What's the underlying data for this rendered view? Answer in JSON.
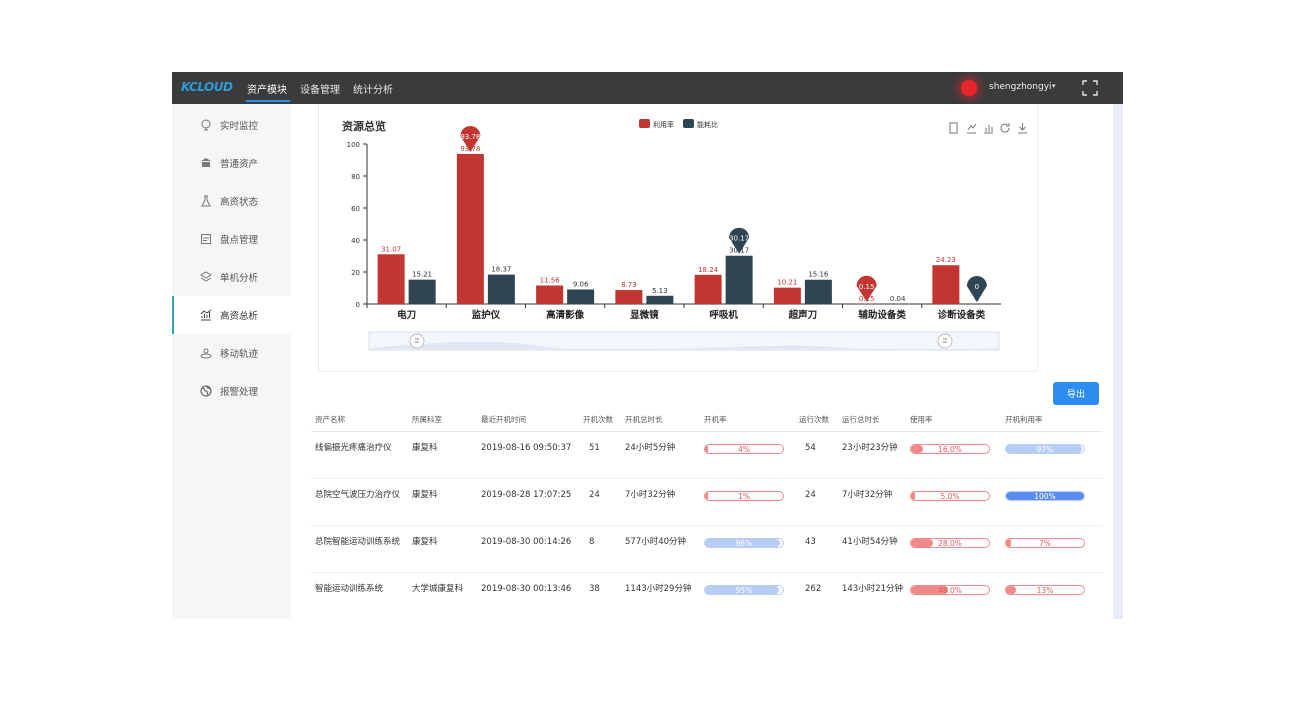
{
  "app": {
    "logo": "KCLOUD",
    "nav": [
      {
        "label": "资产模块",
        "active": true
      },
      {
        "label": "设备管理",
        "active": false
      },
      {
        "label": "统计分析",
        "active": false
      }
    ],
    "username": "shengzhongyi",
    "icons": {
      "user_menu": "chevron-down-icon",
      "fullscreen": "fullscreen-icon",
      "record": "record-dot-icon"
    }
  },
  "sidebar": {
    "items": [
      {
        "label": "实时监控",
        "icon": "monitor-icon",
        "active": false
      },
      {
        "label": "普通资产",
        "icon": "bank-icon",
        "active": false
      },
      {
        "label": "高资状态",
        "icon": "flask-icon",
        "active": false
      },
      {
        "label": "盘点管理",
        "icon": "clipboard-icon",
        "active": false
      },
      {
        "label": "单机分析",
        "icon": "layers-icon",
        "active": false
      },
      {
        "label": "高资总析",
        "icon": "trend-chart-icon",
        "active": true
      },
      {
        "label": "移动轨迹",
        "icon": "route-icon",
        "active": false
      },
      {
        "label": "报警处理",
        "icon": "globe-icon",
        "active": false
      }
    ]
  },
  "colors": {
    "red": "#c23531",
    "navy": "#2f4554",
    "blue": "#2d8cf0",
    "bar_red": "#f08a8a",
    "bar_blue": "#b7cdf4"
  },
  "chart_data": {
    "type": "bar",
    "title": "资源总览",
    "categories": [
      "电刀",
      "监护仪",
      "高清影像",
      "显微镜",
      "呼吸机",
      "超声刀",
      "辅助设备类",
      "诊断设备类"
    ],
    "series": [
      {
        "name": "利用率",
        "values": [
          31.07,
          93.78,
          11.56,
          8.73,
          18.24,
          10.21,
          0.15,
          24.23
        ]
      },
      {
        "name": "能耗比",
        "values": [
          15.21,
          18.37,
          9.06,
          5.13,
          30.17,
          15.16,
          0.04,
          0
        ]
      }
    ],
    "ylim": [
      0,
      100
    ],
    "yticks": [
      0,
      20,
      40,
      60,
      80,
      100
    ],
    "grid": false,
    "legend": "top-center",
    "markers": [
      {
        "series": 0,
        "index": 1,
        "label": "93.78"
      },
      {
        "series": 1,
        "index": 4,
        "label": "30.17"
      },
      {
        "series": 0,
        "index": 6,
        "label": "0.15"
      },
      {
        "series": 1,
        "index": 7,
        "label": "0"
      }
    ],
    "toolbox": [
      "data-view-icon",
      "line-chart-icon",
      "bar-chart-icon",
      "refresh-icon",
      "download-icon"
    ]
  },
  "export_label": "导出",
  "table": {
    "headers": [
      "资产名称",
      "所属科室",
      "最近开机时间",
      "开机次数",
      "开机总时长",
      "开机率",
      "运行次数",
      "运行总时长",
      "使用率",
      "开机利用率"
    ],
    "rows": [
      {
        "name": "线偏振光疼痛治疗仪",
        "dept": "康复科",
        "time": "2019-08-16 09:50:37",
        "boots": "51",
        "boot_dur": "24小时5分钟",
        "boot_rate": {
          "text": "4%",
          "value": 4
        },
        "runs": "54",
        "run_dur": "23小时23分钟",
        "use_rate": {
          "text": "16.0%",
          "value": 16
        },
        "util": {
          "text": "97%",
          "value": 97
        }
      },
      {
        "name": "总院空气波压力治疗仪",
        "dept": "康复科",
        "time": "2019-08-28 17:07:25",
        "boots": "24",
        "boot_dur": "7小时32分钟",
        "boot_rate": {
          "text": "1%",
          "value": 1
        },
        "runs": "24",
        "run_dur": "7小时32分钟",
        "use_rate": {
          "text": "5.0%",
          "value": 5
        },
        "util": {
          "text": "100%",
          "value": 100
        }
      },
      {
        "name": "总院智能运动训练系统",
        "dept": "康复科",
        "time": "2019-08-30 00:14:26",
        "boots": "8",
        "boot_dur": "577小时40分钟",
        "boot_rate": {
          "text": "96%",
          "value": 96
        },
        "runs": "43",
        "run_dur": "41小时54分钟",
        "use_rate": {
          "text": "28.0%",
          "value": 28
        },
        "util": {
          "text": "7%",
          "value": 7
        }
      },
      {
        "name": "智能运动训练系统",
        "dept": "大学城康复科",
        "time": "2019-08-30 00:13:46",
        "boots": "38",
        "boot_dur": "1143小时29分钟",
        "boot_rate": {
          "text": "95%",
          "value": 95
        },
        "runs": "262",
        "run_dur": "143小时21分钟",
        "use_rate": {
          "text": "48.0%",
          "value": 48
        },
        "util": {
          "text": "13%",
          "value": 13
        }
      }
    ]
  }
}
